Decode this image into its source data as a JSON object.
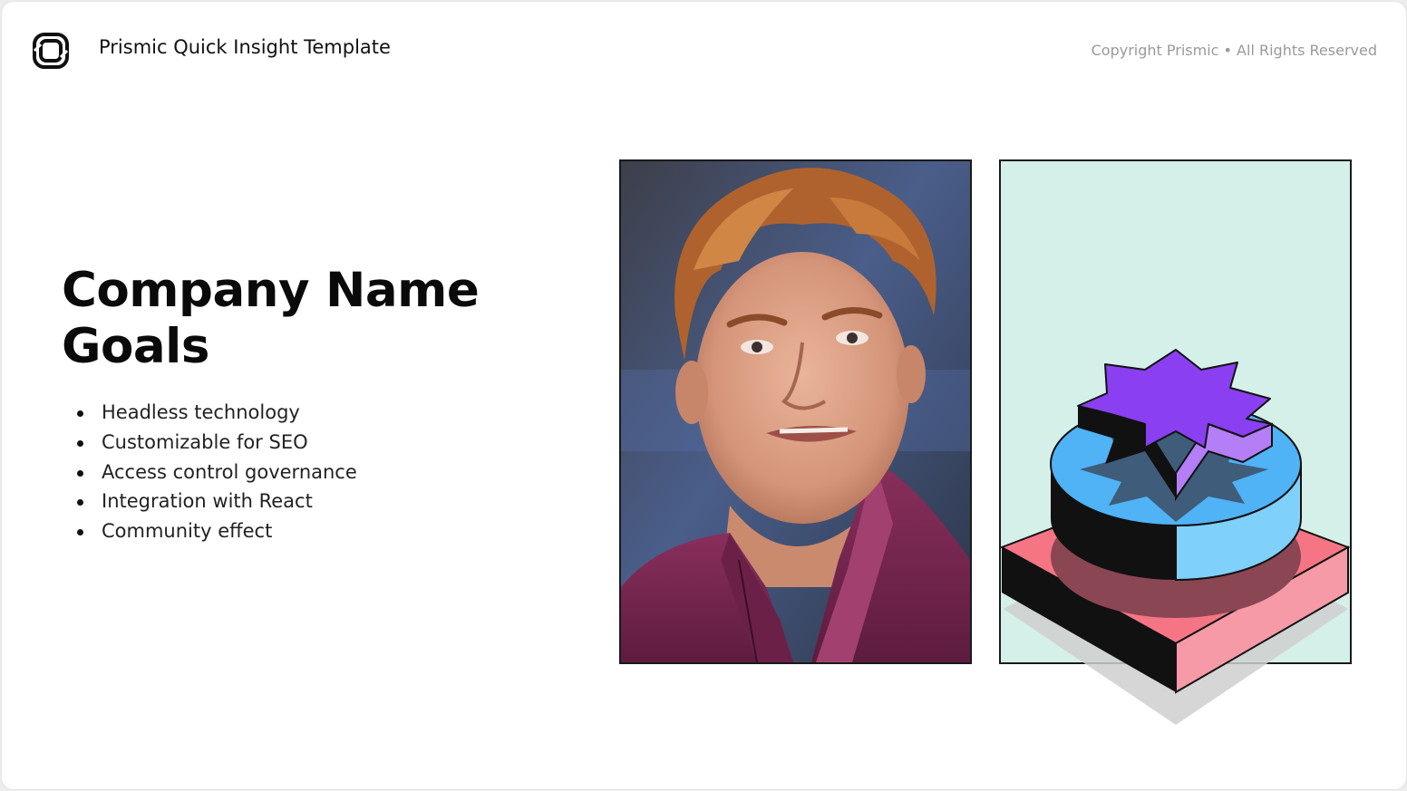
{
  "header": {
    "brand_title": "Prismic Quick Insight Template",
    "copyright": "Copyright Prismic • All Rights Reserved",
    "logo_icon": "prismic-logo-icon"
  },
  "main": {
    "heading_line1": "Company Name",
    "heading_line2": "Goals",
    "bullets": [
      "Headless technology",
      "Customizable for SEO",
      "Access control governance",
      "Integration with React",
      "Community effect"
    ]
  },
  "media": {
    "photo": "portrait-photo",
    "illustration": "stacked-shapes-illustration"
  },
  "colors": {
    "illustration_bg": "#d5f0e8",
    "star_purple": "#8a3ff0",
    "disc_blue": "#4fb3f5",
    "base_pink": "#f67585",
    "ink": "#111111"
  }
}
